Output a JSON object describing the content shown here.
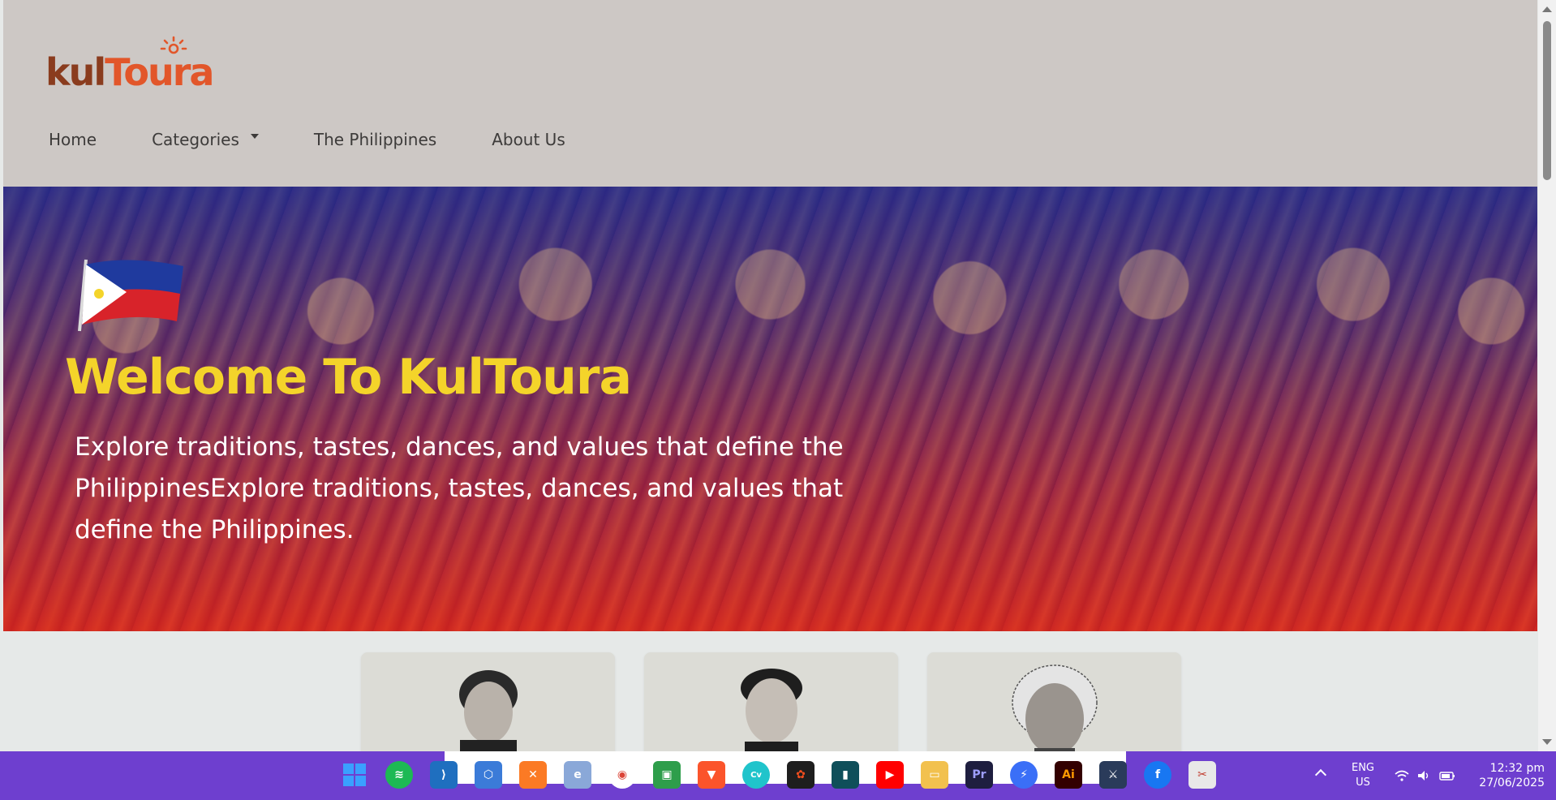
{
  "header": {
    "logo": {
      "part1": "kul",
      "part2": "Toura"
    },
    "nav": [
      {
        "label": "Home"
      },
      {
        "label": "Categories",
        "has_dropdown": true
      },
      {
        "label": "The Philippines"
      },
      {
        "label": "About Us"
      }
    ]
  },
  "hero": {
    "title": "Welcome To KulToura",
    "subtitle": "Explore traditions, tastes, dances, and values that define the PhilippinesExplore traditions, tastes, dances, and values that define the Philippines."
  },
  "cards": [
    {
      "icon": "portrait-1"
    },
    {
      "icon": "portrait-2"
    },
    {
      "icon": "portrait-3"
    }
  ],
  "taskbar": {
    "apps": [
      "windows-start",
      "spotify",
      "vscode",
      "app-hex",
      "xampp",
      "edge",
      "chrome",
      "classroom",
      "brave",
      "canva",
      "figma",
      "terminal",
      "youtube",
      "file-explorer",
      "premiere-pro",
      "messenger",
      "illustrator",
      "game",
      "facebook",
      "snipping-tool"
    ],
    "language": {
      "line1": "ENG",
      "line2": "US"
    },
    "clock": {
      "time": "12:32 pm",
      "date": "27/06/2025"
    }
  },
  "colors": {
    "header_bg": "#cdc8c5",
    "logo_kul": "#8a3c1e",
    "logo_toura": "#e2562a",
    "hero_title": "#f4d42a",
    "taskbar": "#6e3fcf"
  }
}
